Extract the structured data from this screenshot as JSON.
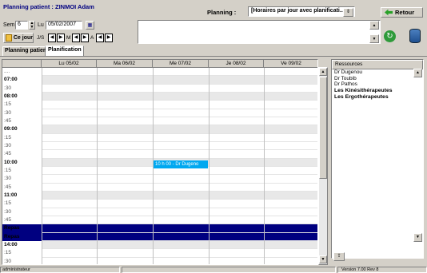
{
  "header": {
    "title": "Planning patient : ZINMOI Adam",
    "planning_label": "Planning :",
    "planning_select": "[Horaires par jour avec planificati...",
    "retour_label": "Retour"
  },
  "controls": {
    "sem_label": "Sem",
    "sem_value": "6",
    "day_label": "Lu",
    "date_value": "05/02/2007",
    "today_label": "Ce jour",
    "js_label": "J/S",
    "m_label": "M",
    "a_label": "A"
  },
  "tabs": [
    "Planning patient",
    "Planification"
  ],
  "grid": {
    "days": [
      "Lu 05/02",
      "Ma 06/02",
      "Me 07/02",
      "Je 08/02",
      "Ve 09/02"
    ],
    "times": [
      "....",
      "07:00",
      ":30",
      "08:00",
      ":15",
      ":30",
      ":45",
      "09:00",
      ":15",
      ":30",
      ":45",
      "10:00",
      ":15",
      ":30",
      ":45",
      "11:00",
      ":15",
      ":30",
      ":45",
      "Repas",
      "Repas",
      "14:00",
      ":15",
      ":30"
    ],
    "appointment": "10 h 00 - Dr Dugeno"
  },
  "resources": {
    "header": "Ressources",
    "items": [
      "Dr Dugenou",
      "Dr Toubib",
      "Dr Pathos",
      "Les Kinésithérapeutes",
      "Les Ergothérapeutes"
    ]
  },
  "status": {
    "user": "administrateur",
    "version": "Version 7.00 Rev 8"
  },
  "colors": {
    "title_blue": "#000080",
    "repas_row": "#000080",
    "appointment": "#00a8f0",
    "retour_icon": "#28a028"
  }
}
